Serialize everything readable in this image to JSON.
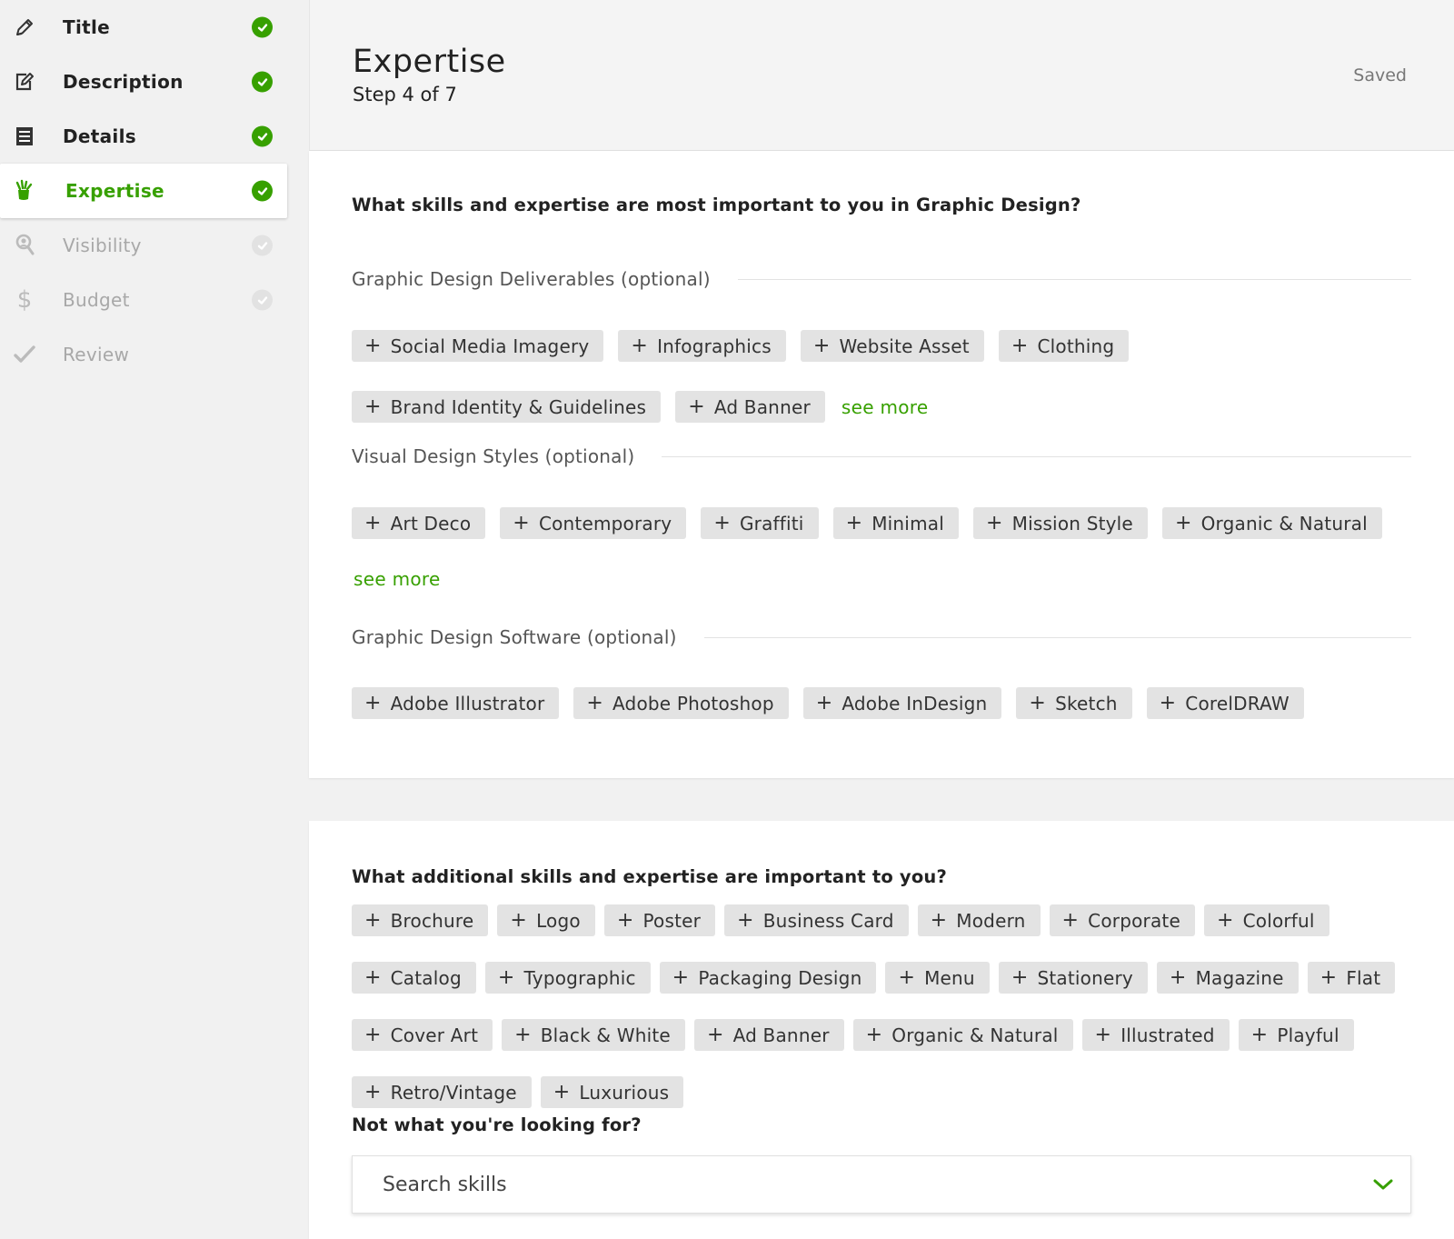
{
  "sidebar": {
    "items": [
      {
        "label": "Title",
        "icon": "pencil-icon",
        "state": "done"
      },
      {
        "label": "Description",
        "icon": "edit-icon",
        "state": "done"
      },
      {
        "label": "Details",
        "icon": "list-icon",
        "state": "done"
      },
      {
        "label": "Expertise",
        "icon": "hand-icon",
        "state": "active"
      },
      {
        "label": "Visibility",
        "icon": "user-search-icon",
        "state": "pending"
      },
      {
        "label": "Budget",
        "icon": "dollar-icon",
        "state": "pending"
      },
      {
        "label": "Review",
        "icon": "checkmark-icon",
        "state": "pending"
      }
    ]
  },
  "header": {
    "title": "Expertise",
    "step": "Step 4 of 7",
    "saved": "Saved"
  },
  "card1": {
    "question": "What skills and expertise are most important to you in Graphic Design?",
    "sections": [
      {
        "label": "Graphic Design Deliverables (optional)",
        "chips": [
          "Social Media Imagery",
          "Infographics",
          "Website Asset",
          "Clothing",
          "Brand Identity & Guidelines",
          "Ad Banner"
        ],
        "see_more": "see more"
      },
      {
        "label": "Visual Design Styles (optional)",
        "chips": [
          "Art Deco",
          "Contemporary",
          "Graffiti",
          "Minimal",
          "Mission Style",
          "Organic & Natural"
        ],
        "see_more": "see more"
      },
      {
        "label": "Graphic Design Software (optional)",
        "chips": [
          "Adobe Illustrator",
          "Adobe Photoshop",
          "Adobe InDesign",
          "Sketch",
          "CorelDRAW"
        ]
      }
    ]
  },
  "card2": {
    "question": "What additional skills and expertise are important to you?",
    "chips": [
      "Brochure",
      "Logo",
      "Poster",
      "Business Card",
      "Modern",
      "Corporate",
      "Colorful",
      "Catalog",
      "Typographic",
      "Packaging Design",
      "Menu",
      "Stationery",
      "Magazine",
      "Flat",
      "Cover Art",
      "Black & White",
      "Ad Banner",
      "Organic & Natural",
      "Illustrated",
      "Playful",
      "Retro/Vintage",
      "Luxurious"
    ],
    "not_found": "Not what you're looking for?",
    "search_placeholder": "Search skills"
  },
  "colors": {
    "accent": "#37a000",
    "chip_bg": "#e3e3e3"
  }
}
